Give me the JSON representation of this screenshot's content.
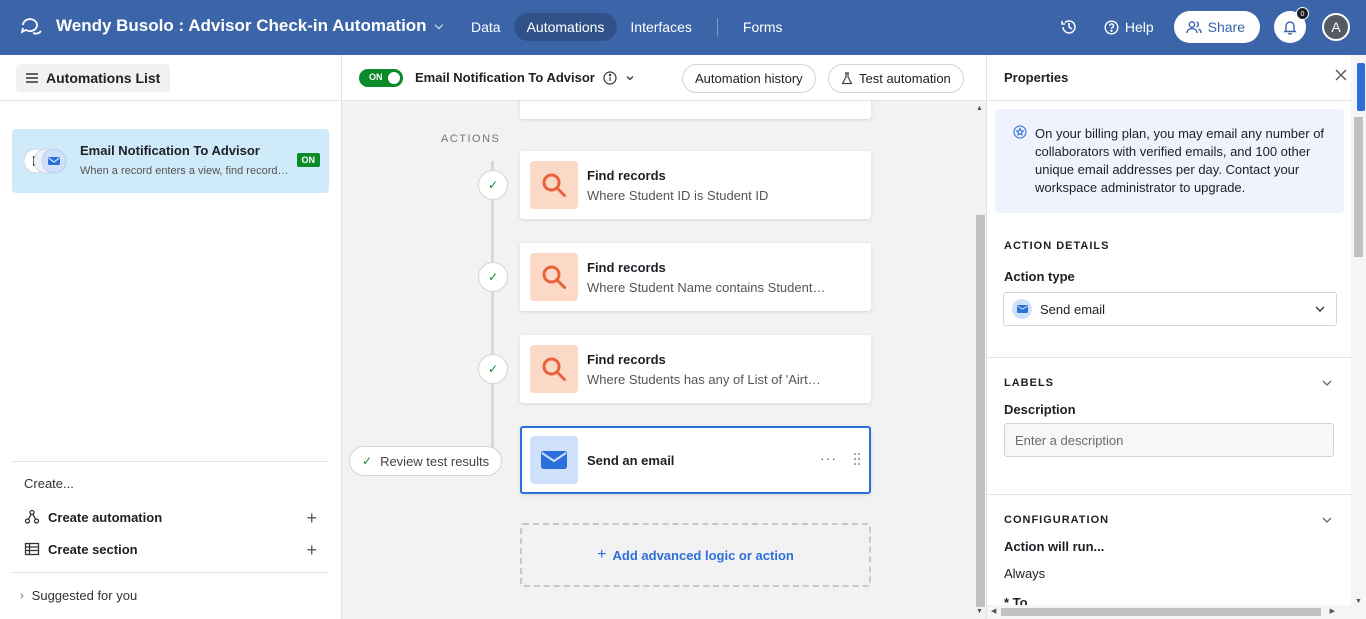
{
  "topbar": {
    "base_title": "Wendy Busolo : Advisor Check-in Automation",
    "tabs": [
      {
        "label": "Data"
      },
      {
        "label": "Automations"
      },
      {
        "label": "Interfaces"
      },
      {
        "label": "Forms"
      }
    ],
    "help_label": "Help",
    "share_label": "Share",
    "notification_count": "0",
    "avatar_initial": "A"
  },
  "sidebar": {
    "list_button_label": "Automations List",
    "automation": {
      "title": "Email Notification To Advisor",
      "subtitle": "When a record enters a view, find records, and send an email",
      "status": "ON"
    },
    "create_label": "Create...",
    "create_items": [
      {
        "label": "Create automation"
      },
      {
        "label": "Create section"
      }
    ],
    "suggested_label": "Suggested for you"
  },
  "editor": {
    "toggle_label": "ON",
    "title": "Email Notification To Advisor",
    "history_button": "Automation history",
    "test_button": "Test automation",
    "actions_label": "ACTIONS",
    "actions": [
      {
        "title": "Find records",
        "subtitle": "Where Student ID is Student ID"
      },
      {
        "title": "Find records",
        "subtitle": "Where Student Name contains Student Name"
      },
      {
        "title": "Find records",
        "subtitle": "Where Students has any of List of 'Airtable record ID'"
      },
      {
        "title": "Send an email",
        "subtitle": ""
      }
    ],
    "more_glyph": "···",
    "review_button": "Review test results",
    "add_label": "Add advanced logic or action"
  },
  "properties": {
    "title": "Properties",
    "billing_notice": "On your billing plan, you may email any number of collaborators with verified emails, and 100 other unique email addresses per day. Contact your workspace administrator to upgrade.",
    "action_details_heading": "ACTION DETAILS",
    "action_type_label": "Action type",
    "action_type_value": "Send email",
    "labels_heading": "LABELS",
    "description_label": "Description",
    "description_placeholder": "Enter a description",
    "configuration_heading": "CONFIGURATION",
    "action_run_label": "Action will run...",
    "action_run_value": "Always",
    "to_label": "* To"
  },
  "colors": {
    "topbar": "#3b65a8",
    "on_green": "#0b8a2c",
    "accent_blue": "#2d6fd8",
    "search_icon_bg": "#fcd9c7",
    "search_icon": "#e8633a"
  }
}
